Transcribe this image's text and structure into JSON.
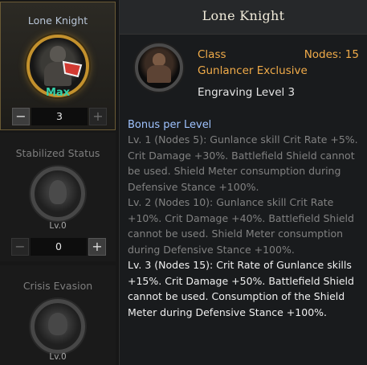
{
  "slots": [
    {
      "title": "Lone Knight",
      "max_label": "Max",
      "value": "3",
      "minus": "−",
      "plus": "+",
      "icon": "lone-knight-icon"
    },
    {
      "title": "Stabilized Status",
      "level_label": "Lv.0",
      "value": "0",
      "minus": "−",
      "plus": "+",
      "icon": "stabilized-status-icon"
    },
    {
      "title": "Crisis Evasion",
      "level_label": "Lv.0",
      "icon": "crisis-evasion-icon"
    }
  ],
  "panel": {
    "title": "Lone Knight",
    "class_label": "Class",
    "nodes_label": "Nodes: 15",
    "class_value": "Gunlancer Exclusive",
    "engraving_level": "Engraving Level 3",
    "bonus_heading": "Bonus per Level",
    "levels": [
      {
        "text": "Lv. 1 (Nodes 5): Gunlance skill Crit Rate +5%. Crit Damage +30%. Battlefield Shield cannot be used. Shield Meter consumption during Defensive Stance +100%.",
        "active": false
      },
      {
        "text": "Lv. 2 (Nodes 10): Gunlance skill Crit Rate +10%. Crit Damage +40%. Battlefield Shield cannot be used. Shield Meter consumption during Defensive Stance +100%.",
        "active": false
      },
      {
        "text": "Lv. 3 (Nodes 15): Crit Rate of Gunlance skills +15%. Crit Damage +50%. Battlefield Shield cannot be used. Consumption of the Shield Meter during Defensive Stance +100%.",
        "active": true
      }
    ]
  },
  "colors": {
    "accent_orange": "#f0ab49",
    "bonus_blue": "#9fc3ff",
    "max_green": "#34d0a8",
    "gold_ring": "#c3912d"
  }
}
